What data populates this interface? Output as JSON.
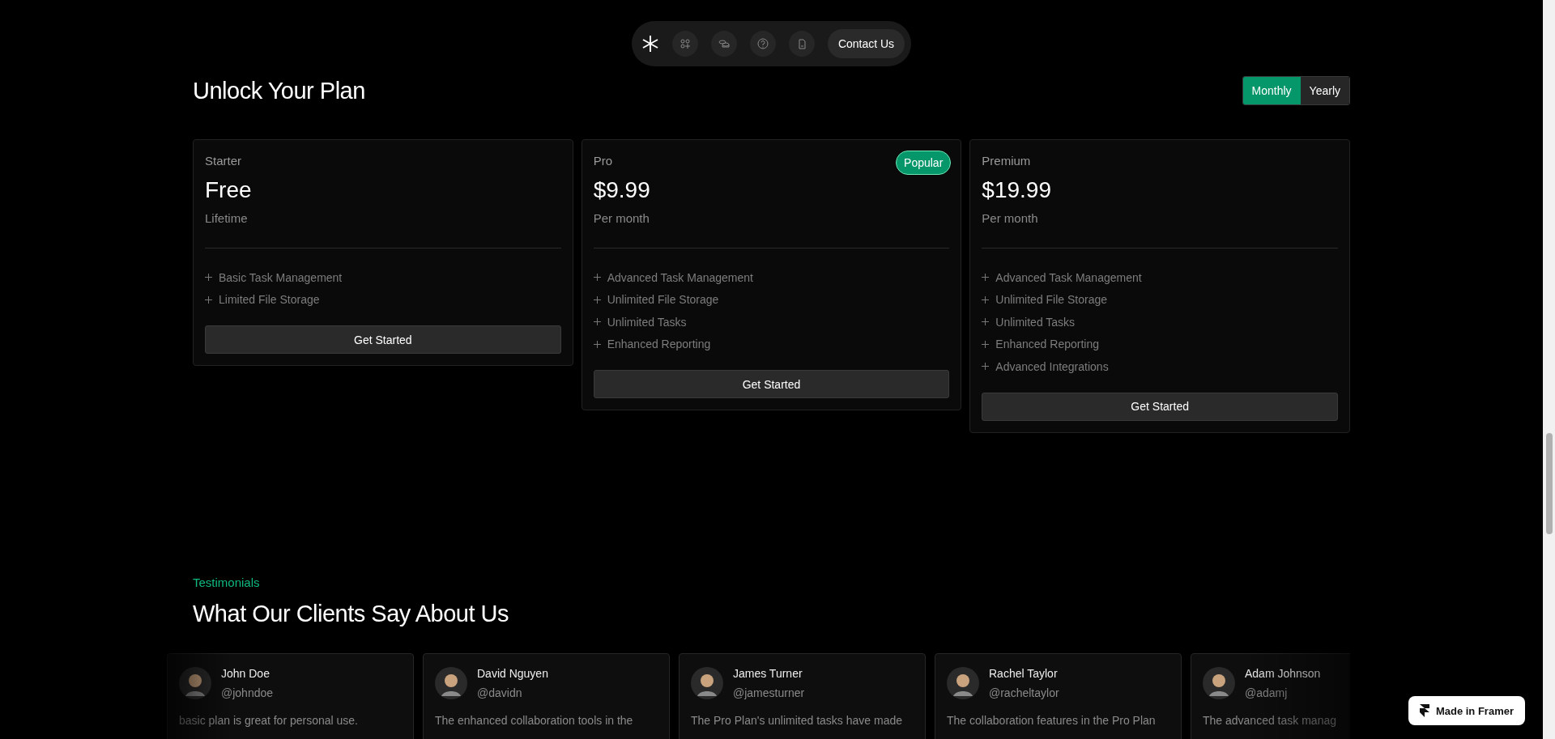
{
  "nav": {
    "contact": "Contact Us"
  },
  "pricing": {
    "title": "Unlock Your Plan",
    "billing": [
      {
        "label": "Monthly",
        "selected": true
      },
      {
        "label": "Yearly",
        "selected": false
      }
    ],
    "plans": [
      {
        "name": "Starter",
        "price": "Free",
        "period": "Lifetime",
        "features": [
          "Basic Task Management",
          "Limited File Storage"
        ],
        "button": "Get Started"
      },
      {
        "name": "Pro",
        "price": "$9.99",
        "period": "Per month",
        "badge": "Popular",
        "features": [
          "Advanced Task Management",
          "Unlimited File Storage",
          "Unlimited Tasks",
          "Enhanced Reporting"
        ],
        "button": "Get Started"
      },
      {
        "name": "Premium",
        "price": "$19.99",
        "period": "Per month",
        "features": [
          "Advanced Task Management",
          "Unlimited File Storage",
          "Unlimited Tasks",
          "Enhanced Reporting",
          "Advanced Integrations"
        ],
        "button": "Get Started"
      }
    ]
  },
  "testimonials": {
    "label": "Testimonials",
    "title": "What Our Clients Say About Us",
    "items": [
      {
        "name": "John Doe",
        "handle": "@johndoe",
        "text": "basic plan is great for personal use."
      },
      {
        "name": "David Nguyen",
        "handle": "@davidn",
        "text": "The enhanced collaboration tools in the"
      },
      {
        "name": "James Turner",
        "handle": "@jamesturner",
        "text": "The Pro Plan's unlimited tasks have made"
      },
      {
        "name": "Rachel Taylor",
        "handle": "@racheltaylor",
        "text": "The collaboration features in the Pro Plan"
      },
      {
        "name": "Adam Johnson",
        "handle": "@adamj",
        "text": "The advanced task manag"
      }
    ]
  },
  "badge": "Made in Framer"
}
